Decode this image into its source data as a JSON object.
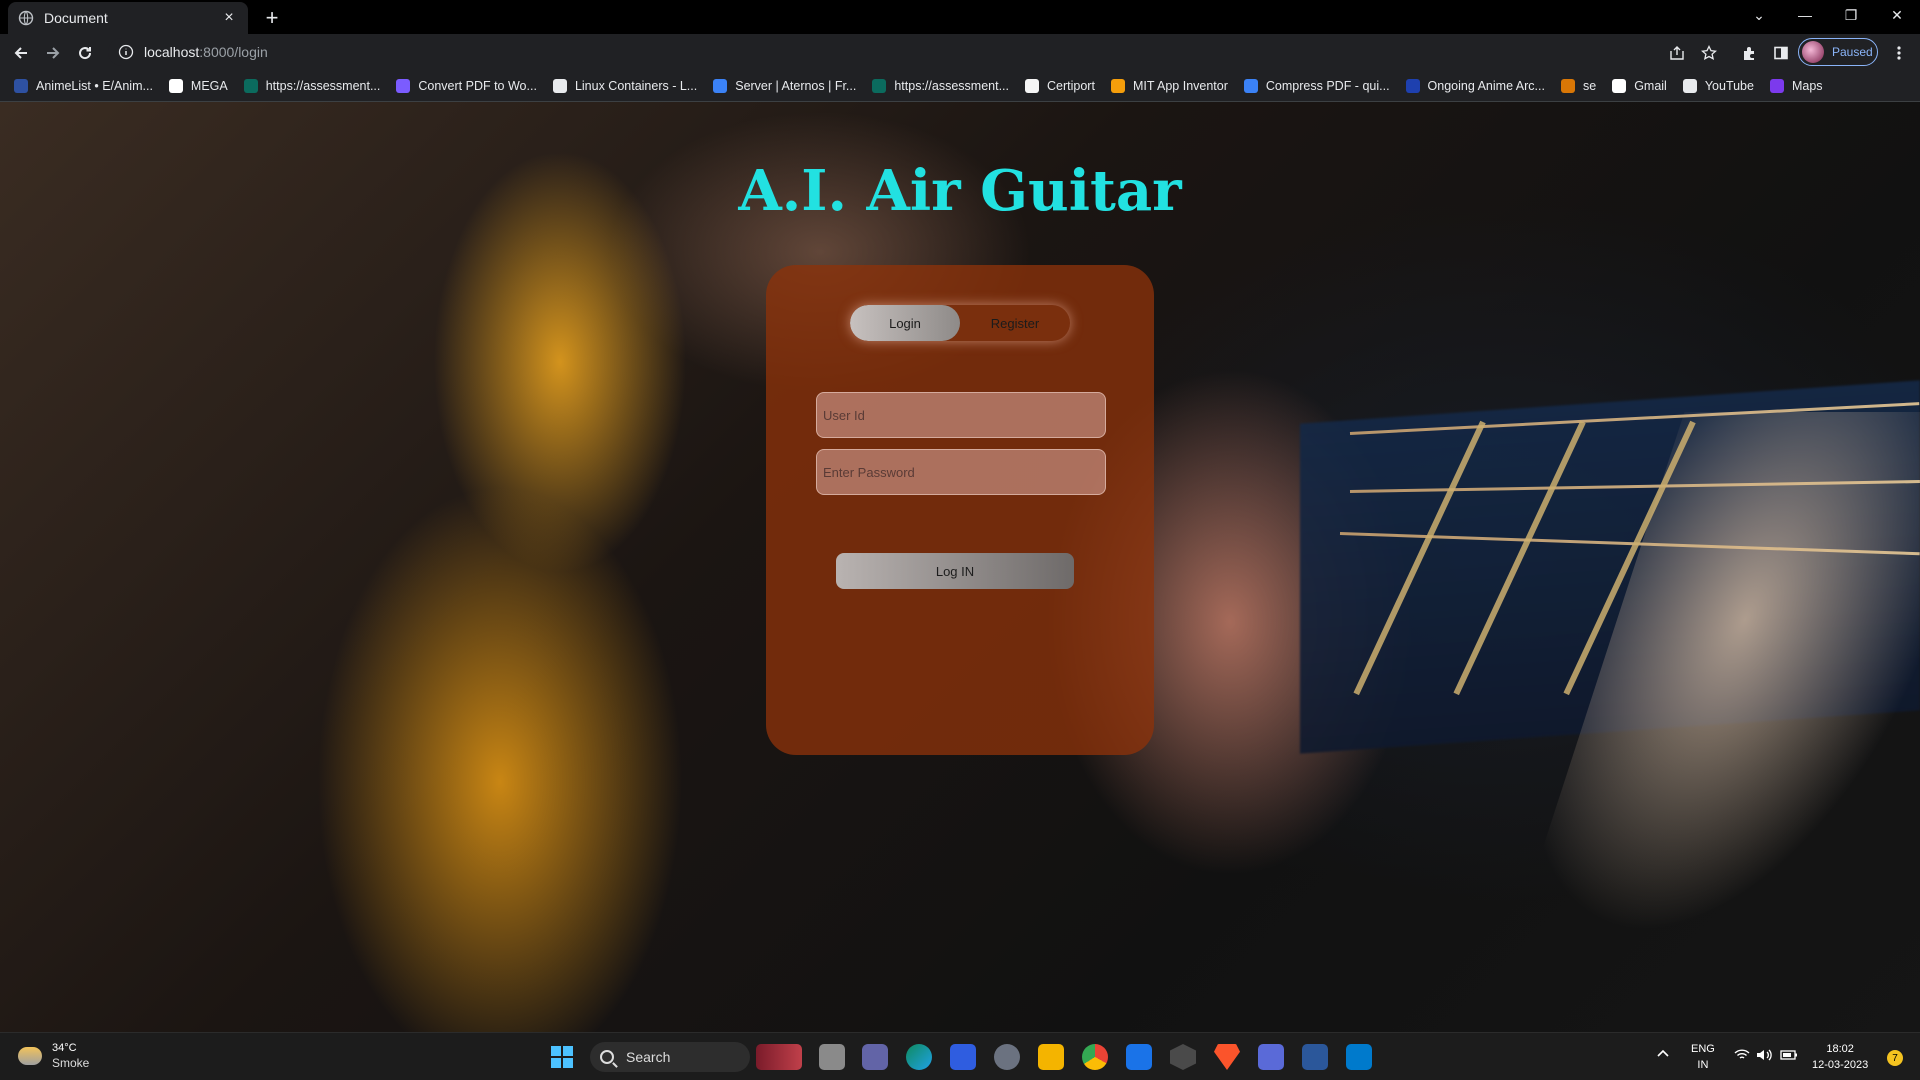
{
  "browser": {
    "tab_title": "Document",
    "tab_close": "×",
    "new_tab": "+",
    "url_host": "localhost",
    "url_path": ":8000/login",
    "window_controls": {
      "chevron": "⌄",
      "minimize": "—",
      "restore": "❐",
      "close": "✕"
    },
    "profile_status": "Paused"
  },
  "bookmarks": [
    {
      "label": "AnimeList • E/Anim...",
      "color": "#2e51a2"
    },
    {
      "label": "MEGA",
      "color": "#ffffff"
    },
    {
      "label": "https://assessment...",
      "color": "#0b6b5e"
    },
    {
      "label": "Convert PDF to Wo...",
      "color": "#7b5cff"
    },
    {
      "label": "Linux Containers - L...",
      "color": "#e8eaed"
    },
    {
      "label": "Server | Aternos | Fr...",
      "color": "#3b82f6"
    },
    {
      "label": "https://assessment...",
      "color": "#0b6b5e"
    },
    {
      "label": "Certiport",
      "color": "#f5f5f5"
    },
    {
      "label": "MIT App Inventor",
      "color": "#f59e0b"
    },
    {
      "label": "Compress PDF - qui...",
      "color": "#3b82f6"
    },
    {
      "label": "Ongoing Anime Arc...",
      "color": "#1e40af"
    },
    {
      "label": "se",
      "color": "#d97706"
    },
    {
      "label": "Gmail",
      "color": "#ffffff"
    },
    {
      "label": "YouTube",
      "color": "#e8eaed"
    },
    {
      "label": "Maps",
      "color": "#7c3aed"
    }
  ],
  "page": {
    "title": "A.I. Air Guitar",
    "tabs": {
      "login": "Login",
      "register": "Register"
    },
    "user_placeholder": "User Id",
    "password_placeholder": "Enter Password",
    "submit_label": "Log IN",
    "colors": {
      "title": "#22e1e1",
      "card": "#8c320a"
    }
  },
  "taskbar": {
    "temperature": "34°C",
    "condition": "Smoke",
    "search_label": "Search",
    "language_line1": "ENG",
    "language_line2": "IN",
    "time": "18:02",
    "date": "12-03-2023",
    "notification_count": "7"
  }
}
